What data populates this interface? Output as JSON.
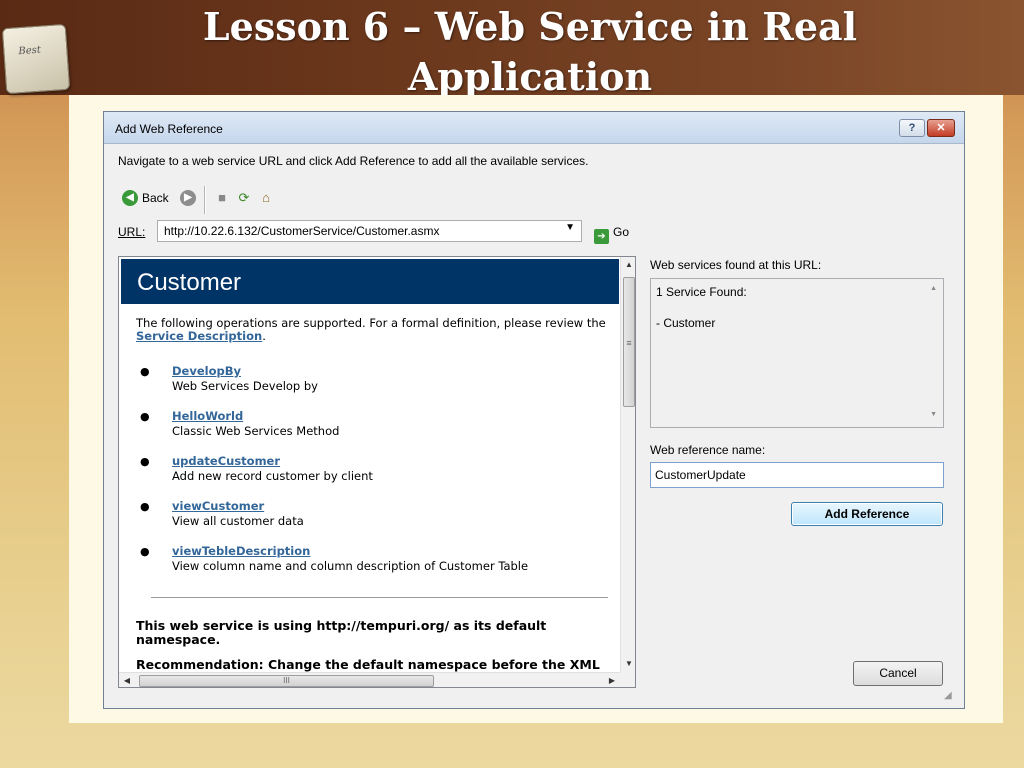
{
  "slide": {
    "title": "Lesson 6 – Web Service in Real Application",
    "logo_text": "Best"
  },
  "dialog": {
    "title": "Add Web Reference",
    "help_button": "?",
    "close_button": "✕",
    "instruction": "Navigate to a web service URL and click Add Reference to add all the available services.",
    "toolbar": {
      "back_label": "Back"
    },
    "url": {
      "label_underlined": "U",
      "label_rest": "RL:",
      "value": "http://10.22.6.132/CustomerService/Customer.asmx",
      "go_label": "Go"
    },
    "browser_page": {
      "header": "Customer",
      "intro_text": "The following operations are supported. For a formal definition, please review the ",
      "intro_link": "Service Description",
      "intro_end": ".",
      "operations": [
        {
          "name": "DevelopBy",
          "description": "Web Services Develop by"
        },
        {
          "name": "HelloWorld",
          "description": "Classic Web Services Method"
        },
        {
          "name": "updateCustomer",
          "description": "Add new record customer by client"
        },
        {
          "name": "viewCustomer",
          "description": "View all customer data"
        },
        {
          "name": "viewTebleDescription",
          "description": "View column name and column description of Customer Table"
        }
      ],
      "namespace_note": "This web service is using http://tempuri.org/ as its default namespace.",
      "recommendation": "Recommendation: Change the default namespace before the XML",
      "scroll_grip": "≡",
      "hscroll_grip": "III"
    },
    "services_panel": {
      "label": "Web services found at this URL:",
      "count": "1 Service Found:",
      "items": [
        "- Customer"
      ]
    },
    "reference_name": {
      "label": "Web reference name:",
      "value": "CustomerUpdate"
    },
    "buttons": {
      "add_reference": "Add Reference",
      "cancel": "Cancel"
    }
  },
  "colors": {
    "header_band": "#5a2a14",
    "page_header": "#003366",
    "link": "#336699"
  }
}
